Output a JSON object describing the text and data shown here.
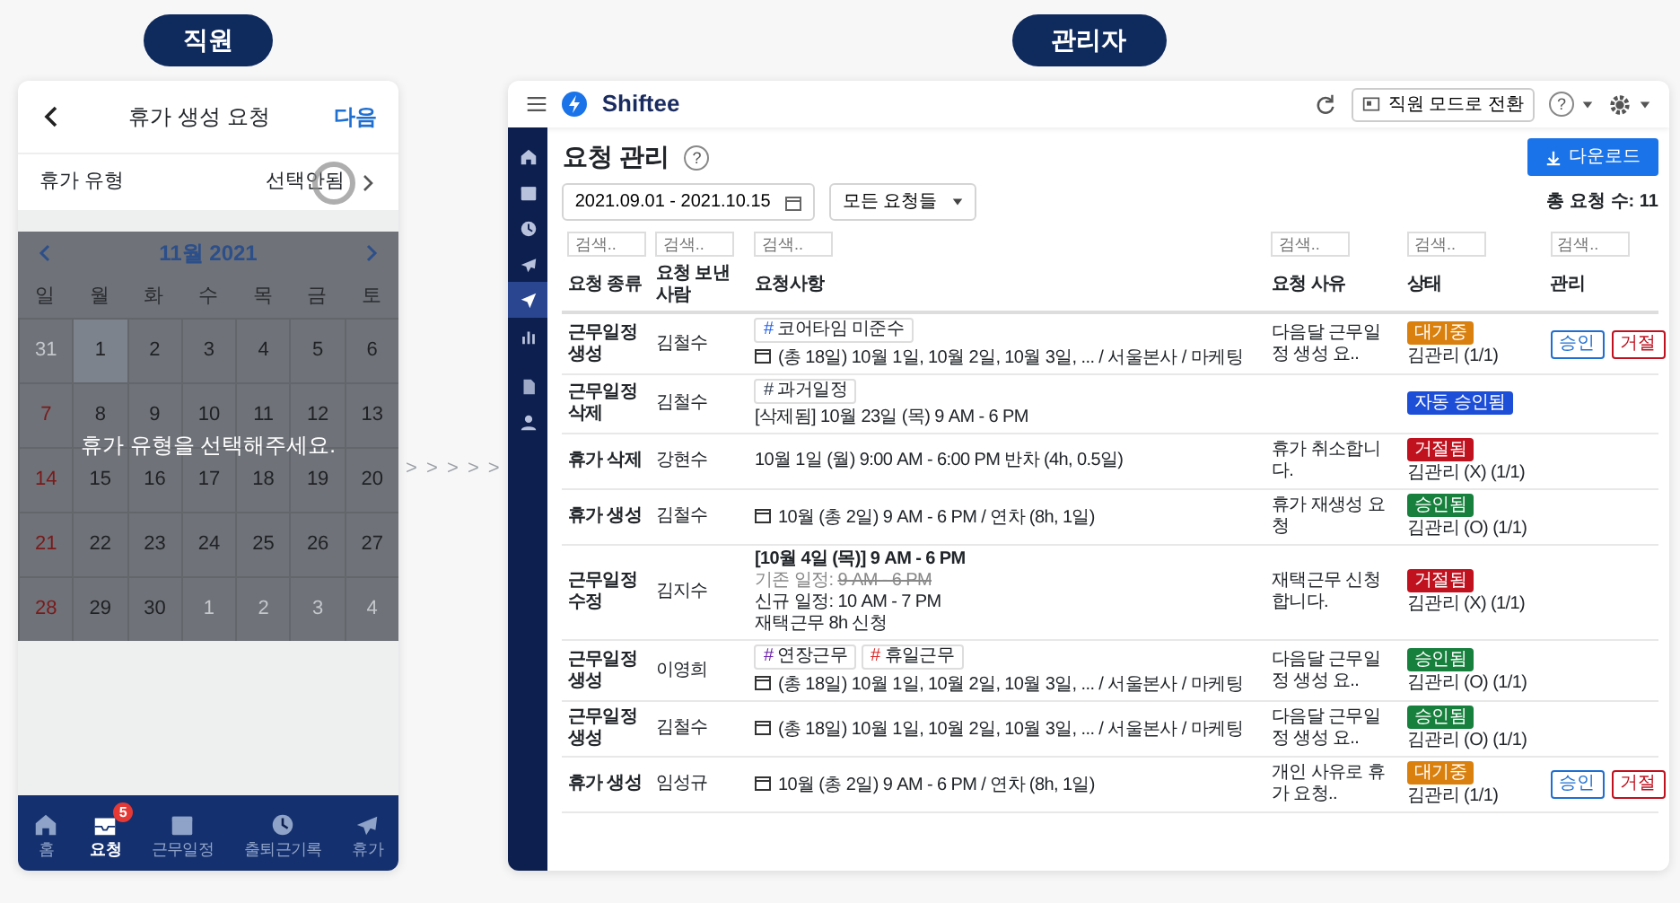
{
  "employee_label": "직원",
  "admin_label": "관리자",
  "arrows": "> > > > >",
  "mobile": {
    "title": "휴가 생성 요청",
    "next": "다음",
    "leave_type": {
      "label": "휴가 유형",
      "value": "선택안됨"
    },
    "calendar": {
      "month": "11월 2021",
      "weekdays": [
        "일",
        "월",
        "화",
        "수",
        "목",
        "금",
        "토"
      ],
      "days": [
        {
          "day": "31",
          "outside": true,
          "selected": false
        },
        {
          "day": "1",
          "outside": false,
          "selected": true
        },
        {
          "day": "2",
          "outside": false,
          "selected": false
        },
        {
          "day": "3",
          "outside": false,
          "selected": false
        },
        {
          "day": "4",
          "outside": false,
          "selected": false
        },
        {
          "day": "5",
          "outside": false,
          "selected": false
        },
        {
          "day": "6",
          "outside": false,
          "selected": false
        },
        {
          "day": "7",
          "outside": false,
          "selected": false
        },
        {
          "day": "8",
          "outside": false,
          "selected": false
        },
        {
          "day": "9",
          "outside": false,
          "selected": false
        },
        {
          "day": "10",
          "outside": false,
          "selected": false
        },
        {
          "day": "11",
          "outside": false,
          "selected": false
        },
        {
          "day": "12",
          "outside": false,
          "selected": false
        },
        {
          "day": "13",
          "outside": false,
          "selected": false
        },
        {
          "day": "14",
          "outside": false,
          "selected": false
        },
        {
          "day": "15",
          "outside": false,
          "selected": false
        },
        {
          "day": "16",
          "outside": false,
          "selected": false
        },
        {
          "day": "17",
          "outside": false,
          "selected": false
        },
        {
          "day": "18",
          "outside": false,
          "selected": false
        },
        {
          "day": "19",
          "outside": false,
          "selected": false
        },
        {
          "day": "20",
          "outside": false,
          "selected": false
        },
        {
          "day": "21",
          "outside": false,
          "selected": false
        },
        {
          "day": "22",
          "outside": false,
          "selected": false
        },
        {
          "day": "23",
          "outside": false,
          "selected": false
        },
        {
          "day": "24",
          "outside": false,
          "selected": false
        },
        {
          "day": "25",
          "outside": false,
          "selected": false
        },
        {
          "day": "26",
          "outside": false,
          "selected": false
        },
        {
          "day": "27",
          "outside": false,
          "selected": false
        },
        {
          "day": "28",
          "outside": false,
          "selected": false
        },
        {
          "day": "29",
          "outside": false,
          "selected": false
        },
        {
          "day": "30",
          "outside": false,
          "selected": false
        },
        {
          "day": "1",
          "outside": true,
          "selected": false
        },
        {
          "day": "2",
          "outside": true,
          "selected": false
        },
        {
          "day": "3",
          "outside": true,
          "selected": false
        },
        {
          "day": "4",
          "outside": true,
          "selected": false
        }
      ],
      "message": "휴가 유형을 선택해주세요."
    },
    "tabs": [
      {
        "label": "홈",
        "selected": false
      },
      {
        "label": "요청",
        "selected": true,
        "badge": "5"
      },
      {
        "label": "근무일정",
        "selected": false
      },
      {
        "label": "출퇴근기록",
        "selected": false
      },
      {
        "label": "휴가",
        "selected": false
      }
    ]
  },
  "admin": {
    "brand": "Shiftee",
    "mode_button": "직원 모드로 전환",
    "help": "?",
    "sidebar": [
      {
        "selected": false
      },
      {
        "selected": false
      },
      {
        "selected": false
      },
      {
        "selected": false
      },
      {
        "selected": true
      },
      {
        "selected": false
      },
      {
        "selected": false
      },
      {
        "selected": false
      }
    ],
    "title": "요청 관리",
    "title_help": "?",
    "download": "다운로드",
    "date_range": "2021.09.01 - 2021.10.15",
    "filter": "모든 요청들",
    "total": "총 요청 수: 11",
    "table": {
      "columns": [
        {
          "label": "요청 종류",
          "placeholder": "검색.."
        },
        {
          "label": "요청 보낸 사람",
          "placeholder": "검색.."
        },
        {
          "label": "요청사항",
          "placeholder": "검색.."
        },
        {
          "label": "요청 사유",
          "placeholder": "검색.."
        },
        {
          "label": "상태",
          "placeholder": "검색.."
        },
        {
          "label": "관리",
          "placeholder": "검색.."
        }
      ],
      "rows": [
        {
          "type": "근무일정 생성",
          "sender": "김철수",
          "details": [
            {
              "kind": "tags",
              "tags": [
                {
                  "mark": "#",
                  "label": "코어타임 미준수",
                  "color": "#2563eb"
                }
              ]
            },
            {
              "kind": "schedule",
              "text": "(총 18일) 10월 1일, 10월 2일, 10월 3일, ... / 서울본사 / 마케팅"
            }
          ],
          "reason": "다음달 근무일정 생성 요..",
          "status": {
            "label": "대기중",
            "color": "#d9800f"
          },
          "approver": "김관리 (1/1)",
          "actions": [
            {
              "kind": "approve",
              "label": "승인"
            },
            {
              "kind": "reject",
              "label": "거절"
            }
          ]
        },
        {
          "type": "근무일정 삭제",
          "sender": "김철수",
          "details": [
            {
              "kind": "tags",
              "tags": [
                {
                  "mark": "#",
                  "label": "과거일정",
                  "color": "#374151"
                }
              ]
            },
            {
              "kind": "text",
              "text": "[삭제됨] 10월 23일 (목) 9 AM - 6 PM"
            }
          ],
          "status": {
            "label": "자동 승인됨",
            "color": "#1d4ed8"
          }
        },
        {
          "type": "휴가 삭제",
          "sender": "강현수",
          "details": [
            {
              "kind": "text",
              "text": "10월 1일 (월) 9:00 AM - 6:00 PM 반차 (4h, 0.5일)"
            }
          ],
          "reason": "휴가 취소합니다.",
          "status": {
            "label": "거절됨",
            "color": "#c0111f"
          },
          "approver": "김관리 (X) (1/1)"
        },
        {
          "type": "휴가 생성",
          "sender": "김철수",
          "details": [
            {
              "kind": "schedule",
              "text": "10월 (총 2일) 9 AM - 6 PM / 연차 (8h, 1일)"
            }
          ],
          "reason": "휴가 재생성 요청",
          "status": {
            "label": "승인됨",
            "color": "#17803d"
          },
          "approver": "김관리 (O) (1/1)"
        },
        {
          "type": "근무일정 수정",
          "sender": "김지수",
          "details": [
            {
              "kind": "bold",
              "text": "[10월 4일 (목)] 9 AM - 6 PM"
            },
            {
              "kind": "change",
              "label": "기존 일정:",
              "text": "9 AM - 6 PM"
            },
            {
              "kind": "text",
              "text": "신규 일정: 10 AM - 7 PM"
            },
            {
              "kind": "text",
              "text": "재택근무 8h 신청"
            }
          ],
          "reason": "재택근무 신청합니다.",
          "status": {
            "label": "거절됨",
            "color": "#c0111f"
          },
          "approver": "김관리 (X) (1/1)"
        },
        {
          "type": "근무일정 생성",
          "sender": "이영희",
          "details": [
            {
              "kind": "tags",
              "tags": [
                {
                  "mark": "#",
                  "label": "연장근무",
                  "color": "#6b21a8"
                },
                {
                  "mark": "#",
                  "label": "휴일근무",
                  "color": "#dc2626"
                }
              ]
            },
            {
              "kind": "schedule",
              "text": "(총 18일) 10월 1일, 10월 2일, 10월 3일, ... / 서울본사 / 마케팅"
            }
          ],
          "reason": "다음달 근무일정 생성 요..",
          "status": {
            "label": "승인됨",
            "color": "#17803d"
          },
          "approver": "김관리 (O) (1/1)"
        },
        {
          "type": "근무일정 생성",
          "sender": "김철수",
          "details": [
            {
              "kind": "schedule",
              "text": "(총 18일) 10월 1일, 10월 2일, 10월 3일, ... / 서울본사 / 마케팅"
            }
          ],
          "reason": "다음달 근무일정 생성 요..",
          "status": {
            "label": "승인됨",
            "color": "#17803d"
          },
          "approver": "김관리 (O) (1/1)"
        },
        {
          "type": "휴가 생성",
          "sender": "임성규",
          "details": [
            {
              "kind": "schedule",
              "text": "10월 (총 2일) 9 AM - 6 PM / 연차 (8h, 1일)"
            }
          ],
          "reason": "개인 사유로 휴가 요청..",
          "status": {
            "label": "대기중",
            "color": "#d9800f"
          },
          "approver": "김관리 (1/1)",
          "actions": [
            {
              "kind": "approve",
              "label": "승인"
            },
            {
              "kind": "reject",
              "label": "거절"
            }
          ]
        }
      ]
    }
  }
}
